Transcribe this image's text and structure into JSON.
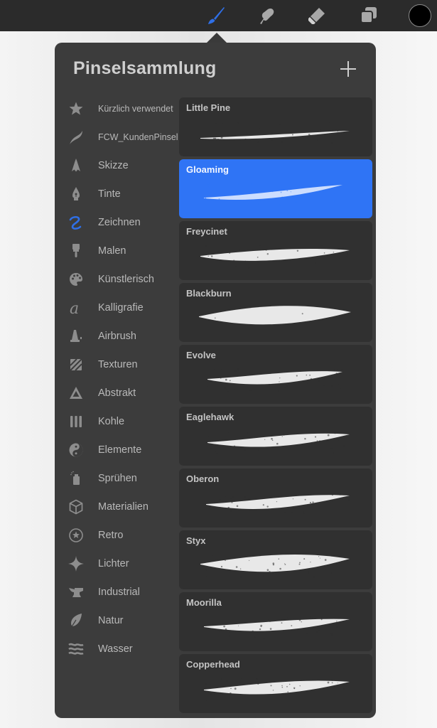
{
  "toolbar": {
    "tools": [
      {
        "name": "brush",
        "icon": "brush-icon",
        "active": true
      },
      {
        "name": "smudge",
        "icon": "smudge-icon",
        "active": false
      },
      {
        "name": "eraser",
        "icon": "eraser-icon",
        "active": false
      },
      {
        "name": "layers",
        "icon": "layers-icon",
        "active": false
      }
    ],
    "current_color": "#000000",
    "active_color": "#2f6fe6",
    "inactive_color": "#a8a8a8"
  },
  "panel": {
    "title": "Pinselsammlung",
    "add_label": "+"
  },
  "categories": [
    {
      "label": "Kürzlich verwendet",
      "icon": "star-icon"
    },
    {
      "label": "FCW_KundenPinsel",
      "icon": "custom-stroke-icon"
    },
    {
      "label": "Skizze",
      "icon": "pencil-tip-icon"
    },
    {
      "label": "Tinte",
      "icon": "pen-nib-icon"
    },
    {
      "label": "Zeichnen",
      "icon": "squiggle-icon",
      "selected": true
    },
    {
      "label": "Malen",
      "icon": "paint-brush-icon"
    },
    {
      "label": "Künstlerisch",
      "icon": "palette-icon"
    },
    {
      "label": "Kalligrafie",
      "icon": "calligraphy-a-icon"
    },
    {
      "label": "Airbrush",
      "icon": "airbrush-icon"
    },
    {
      "label": "Texturen",
      "icon": "texture-icon"
    },
    {
      "label": "Abstrakt",
      "icon": "triangle-icon"
    },
    {
      "label": "Kohle",
      "icon": "charcoal-icon"
    },
    {
      "label": "Elemente",
      "icon": "yin-yang-icon"
    },
    {
      "label": "Sprühen",
      "icon": "spray-can-icon"
    },
    {
      "label": "Materialien",
      "icon": "cube-icon"
    },
    {
      "label": "Retro",
      "icon": "star-circle-icon"
    },
    {
      "label": "Lichter",
      "icon": "sparkle-icon"
    },
    {
      "label": "Industrial",
      "icon": "anvil-icon"
    },
    {
      "label": "Natur",
      "icon": "leaf-icon"
    },
    {
      "label": "Wasser",
      "icon": "waves-icon"
    }
  ],
  "brushes": [
    {
      "name": "Little Pine"
    },
    {
      "name": "Gloaming",
      "selected": true
    },
    {
      "name": "Freycinet"
    },
    {
      "name": "Blackburn"
    },
    {
      "name": "Evolve"
    },
    {
      "name": "Eaglehawk"
    },
    {
      "name": "Oberon"
    },
    {
      "name": "Styx"
    },
    {
      "name": "Moorilla"
    },
    {
      "name": "Copperhead"
    }
  ]
}
